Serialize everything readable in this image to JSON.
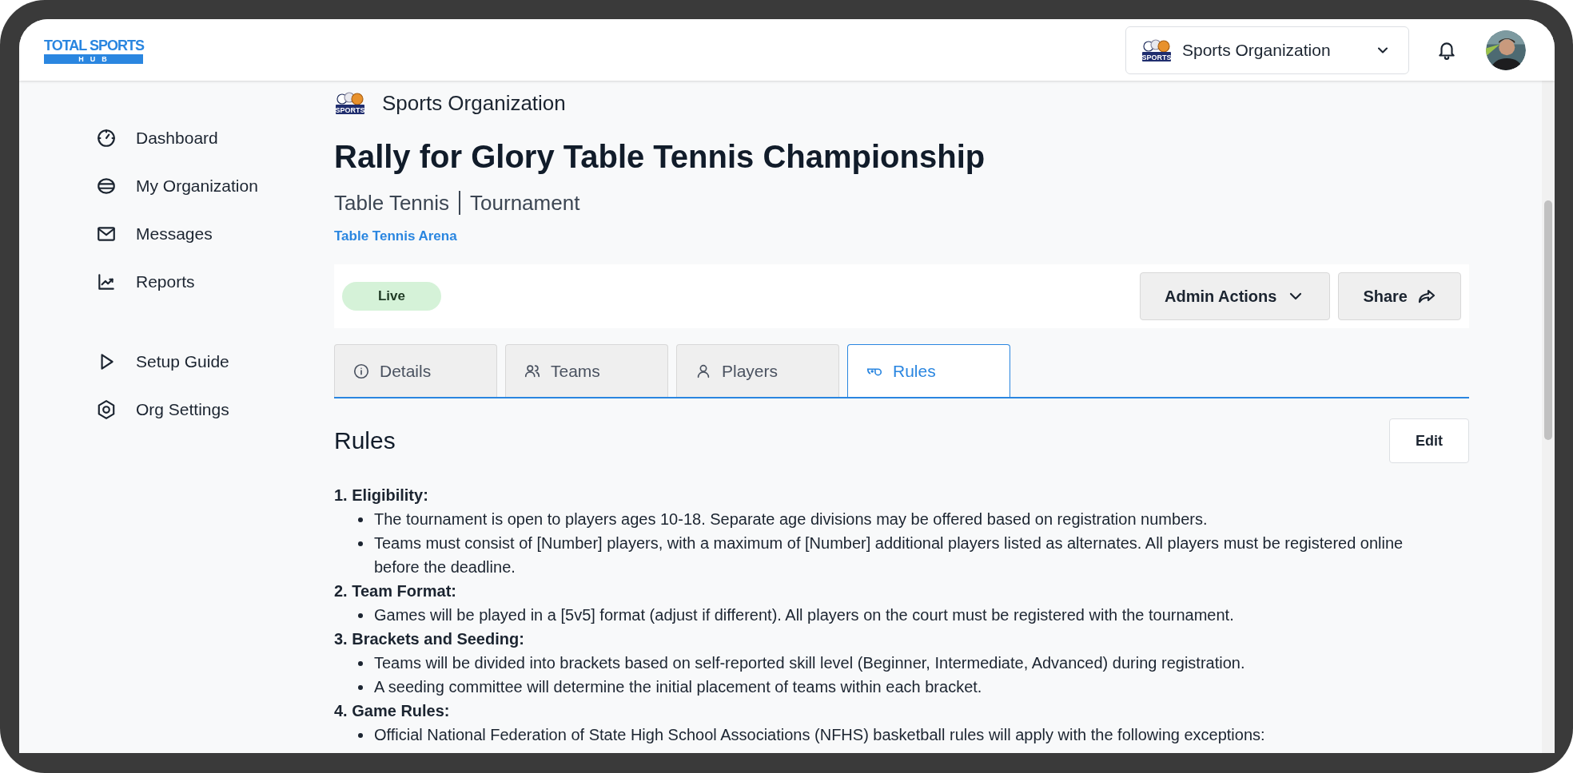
{
  "header": {
    "logo": {
      "title": "TOTAL SPORTS",
      "subtitle": "HUB"
    },
    "org_switcher": {
      "logo_text": "SPORTS",
      "label": "Sports Organization"
    }
  },
  "sidebar": {
    "sections": [
      {
        "items": [
          {
            "label": "Dashboard"
          },
          {
            "label": "My Organization"
          },
          {
            "label": "Messages"
          },
          {
            "label": "Reports"
          }
        ]
      },
      {
        "items": [
          {
            "label": "Setup Guide"
          },
          {
            "label": "Org Settings"
          }
        ]
      }
    ]
  },
  "event": {
    "org_logo_text": "SPORTS",
    "org_name": "Sports Organization",
    "title": "Rally for Glory Table Tennis Championship",
    "sport": "Table Tennis",
    "type": "Tournament",
    "venue": "Table Tennis Arena"
  },
  "status_bar": {
    "status": "Live",
    "actions": [
      "Admin Actions",
      "Share"
    ]
  },
  "tabs": [
    {
      "label": "Details",
      "selected": false
    },
    {
      "label": "Teams",
      "selected": false
    },
    {
      "label": "Players",
      "selected": false
    },
    {
      "label": "Rules",
      "selected": true
    }
  ],
  "rules": {
    "heading": "Rules",
    "edit_button": "Edit",
    "sections": [
      {
        "heading": "1. Eligibility:",
        "items": [
          {
            "text": "The tournament is open to players ages 10-18. Separate age divisions may be offered based on registration numbers."
          },
          {
            "text": "Teams must consist of [Number] players, with a maximum of [Number] additional players listed as alternates. All players must be registered online before the deadline."
          }
        ]
      },
      {
        "heading": "2. Team Format:",
        "items": [
          {
            "text": "Games will be played in a [5v5] format (adjust if different). All players on the court must be registered with the tournament."
          }
        ]
      },
      {
        "heading": "3. Brackets and Seeding:",
        "items": [
          {
            "text": "Teams will be divided into brackets based on self-reported skill level (Beginner, Intermediate, Advanced) during registration."
          },
          {
            "text": "A seeding committee will determine the initial placement of teams within each bracket."
          }
        ]
      },
      {
        "heading": "4. Game Rules:",
        "items": [
          {
            "text": "Official National Federation of State High School Associations (NFHS) basketball rules will apply with the following exceptions:"
          }
        ]
      }
    ]
  }
}
